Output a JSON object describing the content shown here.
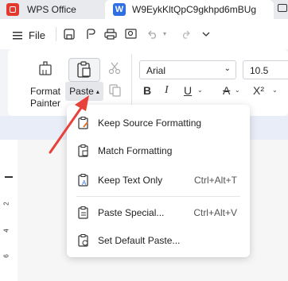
{
  "tabs": {
    "app_tab": "WPS Office",
    "doc_tab": "W9EykKltQpC9gkhpd6mBUg",
    "doc_icon_letter": "W"
  },
  "quickbar": {
    "file_label": "File",
    "icons": [
      "hamburger-menu-icon",
      "save-icon",
      "export-icon",
      "print-icon",
      "zoom-icon",
      "undo-icon",
      "redo-icon",
      "more-icon"
    ]
  },
  "ribbon": {
    "format_painter_label": "Format Painter",
    "paste_label": "Paste",
    "font_name": "Arial",
    "font_size": "10.5",
    "format_buttons": [
      "B",
      "I",
      "U",
      "A",
      "X²"
    ]
  },
  "ruler": {
    "numbers": [
      "2",
      "4",
      "6"
    ]
  },
  "paste_menu": {
    "items": [
      {
        "label": "Keep Source Formatting",
        "shortcut": ""
      },
      {
        "label": "Match Formatting",
        "shortcut": ""
      },
      {
        "label": "Keep Text Only",
        "shortcut": "Ctrl+Alt+T"
      },
      {
        "label": "Paste Special...",
        "shortcut": "Ctrl+Alt+V"
      },
      {
        "label": "Set Default Paste...",
        "shortcut": ""
      }
    ]
  },
  "colors": {
    "accent": "#2f6fe4",
    "wps_red": "#e23a2e",
    "annotation_arrow": "#e8413b"
  }
}
